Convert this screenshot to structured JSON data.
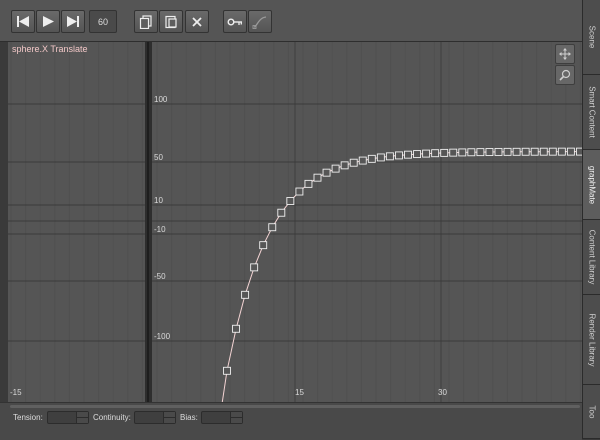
{
  "toolbar": {
    "frame_value": "60",
    "icons": [
      "go-to-start-icon",
      "play-icon",
      "go-to-end-icon",
      "copy-icon",
      "paste-icon",
      "delete-icon",
      "key-icon",
      "curve-icon"
    ]
  },
  "graph": {
    "title": "sphere.X Translate",
    "title_color": "#f2c7c7",
    "curve_color": "#f4d4d4",
    "y_labels": [
      "100",
      "50",
      "10",
      "-10",
      "-50",
      "-100"
    ],
    "x_labels": [
      "-15",
      "15",
      "30"
    ],
    "nav_buttons": [
      "move-icon",
      "zoom-icon"
    ]
  },
  "curve": {
    "key_count": 41,
    "value_at_start": -130,
    "value_at_end": 59
  },
  "bottom": {
    "tension_label": "Tension:",
    "continuity_label": "Continuity:",
    "bias_label": "Bias:",
    "tension_value": "",
    "continuity_value": "",
    "bias_value": ""
  },
  "right_tabs": [
    "Scene",
    "Smart Content",
    "graphMate",
    "Content Library",
    "Render Library",
    "Too"
  ]
}
